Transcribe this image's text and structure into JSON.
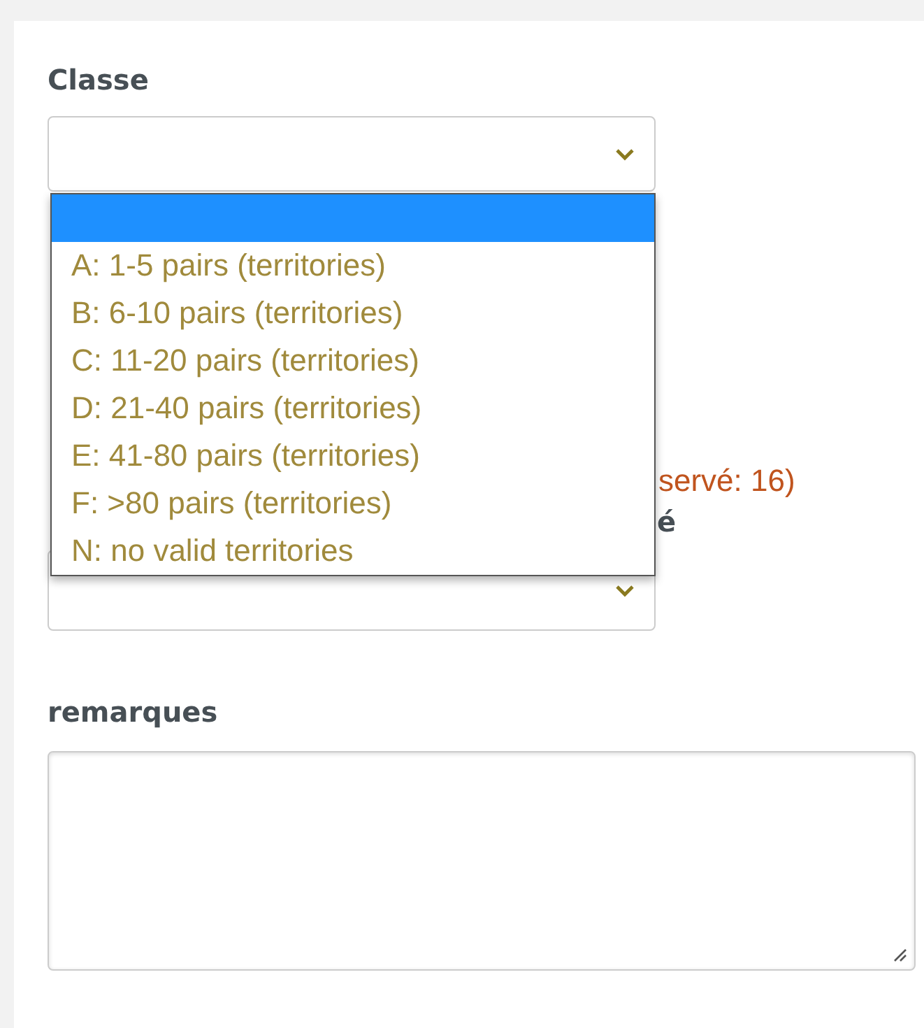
{
  "classe": {
    "label": "Classe"
  },
  "dropdown": {
    "options": [
      {
        "selected": true
      },
      {
        "label": "A: 1-5 pairs (territories)",
        "selected": false
      },
      {
        "label": "B: 6-10 pairs (territories)",
        "selected": false
      },
      {
        "label": "C: 11-20 pairs (territories)",
        "selected": false
      },
      {
        "label": "D: 21-40 pairs (territories)",
        "selected": false
      },
      {
        "label": "E: 41-80 pairs (territories)",
        "selected": false
      },
      {
        "label": "F: >80 pairs (territories)",
        "selected": false
      },
      {
        "label": "N: no valid territories",
        "selected": false
      }
    ]
  },
  "hint": "servé: 16)",
  "second_label": "é",
  "remarques": {
    "label": "remarques"
  }
}
